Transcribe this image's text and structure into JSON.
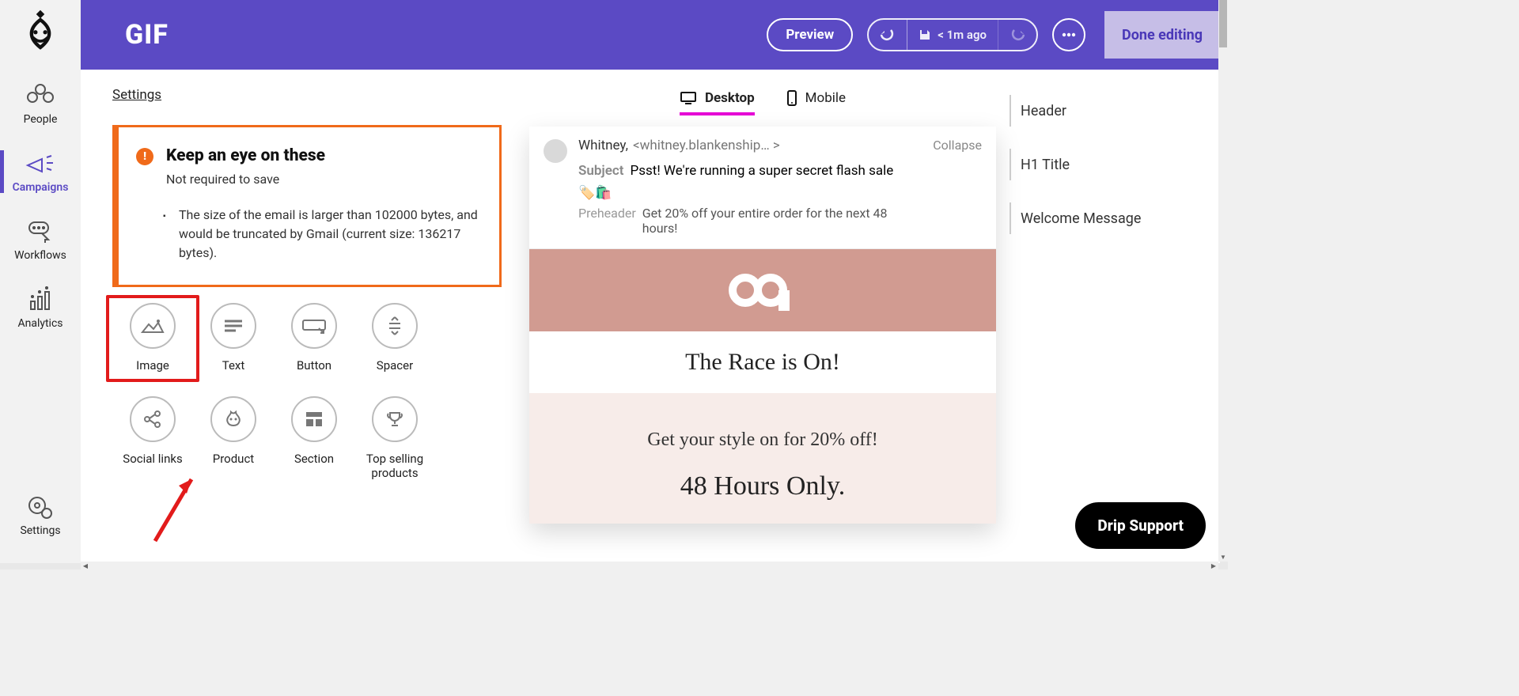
{
  "nav": {
    "items": [
      {
        "label": "People"
      },
      {
        "label": "Campaigns"
      },
      {
        "label": "Workflows"
      },
      {
        "label": "Analytics"
      }
    ],
    "settings_label": "Settings"
  },
  "topbar": {
    "title": "GIF",
    "preview": "Preview",
    "saved": "< 1m ago",
    "done": "Done editing"
  },
  "left": {
    "settings_link": "Settings",
    "warn": {
      "title": "Keep an eye on these",
      "subtitle": "Not required to save",
      "item": "The size of the email is larger than 102000 bytes, and would be truncated by Gmail (current size: 136217 bytes)."
    },
    "blocks": [
      {
        "label": "Image"
      },
      {
        "label": "Text"
      },
      {
        "label": "Button"
      },
      {
        "label": "Spacer"
      },
      {
        "label": "Social links"
      },
      {
        "label": "Product"
      },
      {
        "label": "Section"
      },
      {
        "label": "Top selling products"
      }
    ]
  },
  "tabs": {
    "desktop": "Desktop",
    "mobile": "Mobile"
  },
  "preview": {
    "from_name": "Whitney,",
    "from_addr": "<whitney.blankenship… >",
    "collapse": "Collapse",
    "subject_label": "Subject",
    "subject": "Psst! We're running a super secret flash sale",
    "subject_emoji": "🏷️🛍️",
    "preheader_label": "Preheader",
    "preheader": "Get 20% off your entire order for the next 48 hours!",
    "h1": "The Race is On!",
    "welcome_l1": "Get your style on for 20% off!",
    "welcome_l2": "48 Hours Only."
  },
  "sections": [
    {
      "label": "Header"
    },
    {
      "label": "H1 Title"
    },
    {
      "label": "Welcome Message"
    }
  ],
  "support": "Drip Support"
}
